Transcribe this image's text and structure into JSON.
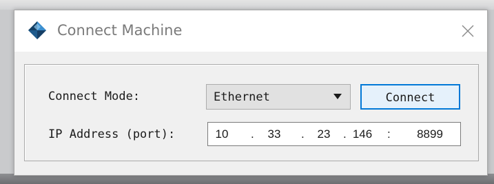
{
  "dialog": {
    "title": "Connect Machine",
    "icon": "diamond-app-icon",
    "close_icon": "close-icon"
  },
  "form": {
    "connect_mode_label": "Connect Mode:",
    "connect_mode_value": "Ethernet",
    "connect_button_label": "Connect",
    "ip_label": "IP Address (port):",
    "ip": {
      "octet1": "10",
      "octet2": "33",
      "octet3": "23",
      "octet4": "146",
      "port": "8899",
      "dot": ".",
      "colon": ":"
    }
  },
  "colors": {
    "accent": "#0078d7",
    "window_bg": "#f0f0f0"
  }
}
